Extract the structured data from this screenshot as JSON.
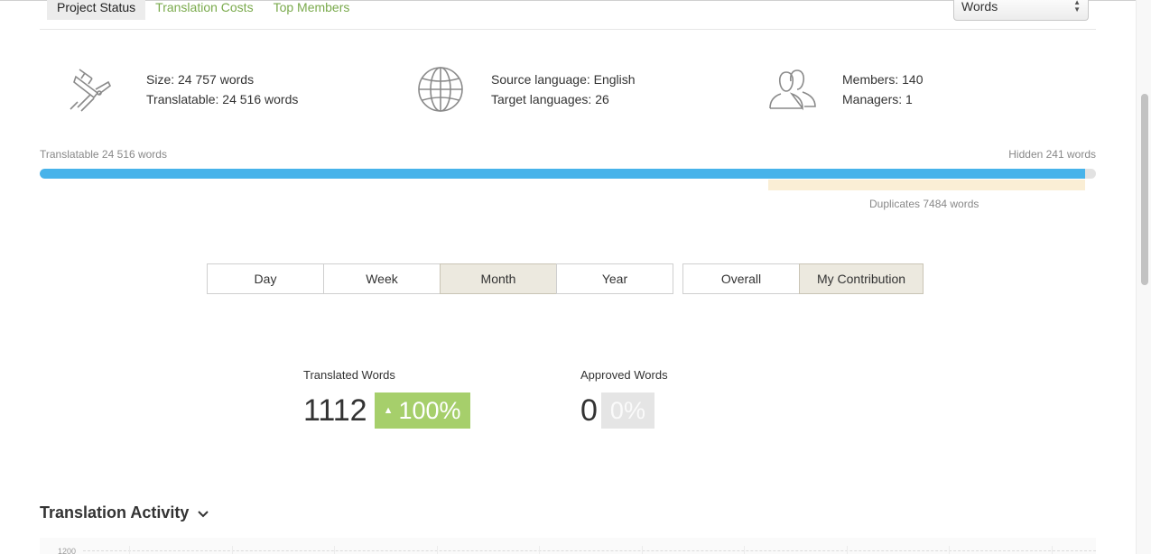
{
  "tabs": [
    {
      "label": "Project Status",
      "active": true
    },
    {
      "label": "Translation Costs",
      "active": false
    },
    {
      "label": "Top Members",
      "active": false
    }
  ],
  "unit_select": {
    "value": "Words"
  },
  "stats": {
    "size": {
      "icon": "caliper-icon",
      "line1": "Size: 24 757 words",
      "line2": "Translatable: 24 516 words"
    },
    "languages": {
      "icon": "globe-icon",
      "line1": "Source language: English",
      "line2": "Target languages: 26"
    },
    "members": {
      "icon": "users-icon",
      "line1": "Members: 140",
      "line2": "Managers: 1"
    }
  },
  "progress": {
    "left_label": "Translatable 24 516 words",
    "right_label": "Hidden 241 words",
    "translatable_fraction": 0.99,
    "duplicates_label": "Duplicates 7484 words",
    "colors": {
      "fill": "#47b3ea",
      "track": "#e2e2e2",
      "duplicates": "#faeed5"
    }
  },
  "period_buttons": [
    {
      "label": "Day",
      "active": false
    },
    {
      "label": "Week",
      "active": false
    },
    {
      "label": "Month",
      "active": true
    },
    {
      "label": "Year",
      "active": false
    }
  ],
  "scope_buttons": [
    {
      "label": "Overall",
      "active": false
    },
    {
      "label": "My Contribution",
      "active": true
    }
  ],
  "metrics": {
    "translated": {
      "label": "Translated Words",
      "value": "1112",
      "badge": "100%",
      "badge_color": "#a6cf6b"
    },
    "approved": {
      "label": "Approved Words",
      "value": "0",
      "badge": "0%",
      "badge_color": "#e5e5e5"
    }
  },
  "activity": {
    "title": "Translation Activity",
    "y_tick": "1200"
  }
}
